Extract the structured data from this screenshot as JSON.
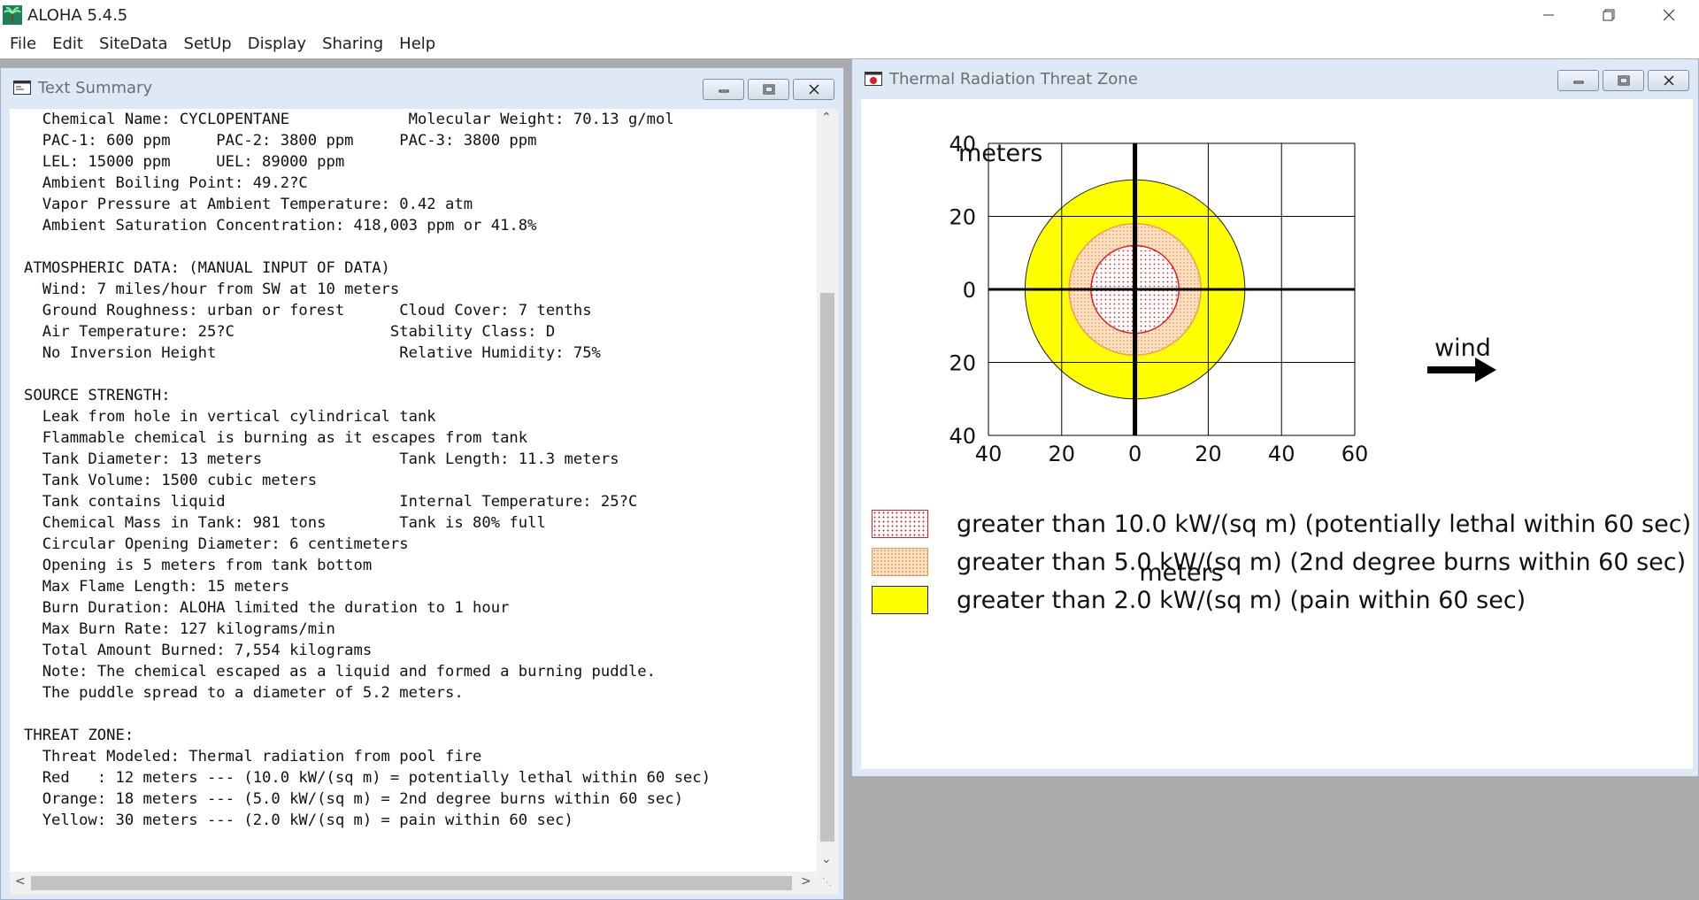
{
  "app": {
    "title": "ALOHA 5.4.5",
    "menu": [
      "File",
      "Edit",
      "SiteData",
      "SetUp",
      "Display",
      "Sharing",
      "Help"
    ]
  },
  "text_window": {
    "title": "Text Summary",
    "lines": [
      "  Chemical Name: CYCLOPENTANE             Molecular Weight: 70.13 g/mol",
      "  PAC-1: 600 ppm     PAC-2: 3800 ppm     PAC-3: 3800 ppm",
      "  LEL: 15000 ppm     UEL: 89000 ppm",
      "  Ambient Boiling Point: 49.2?C",
      "  Vapor Pressure at Ambient Temperature: 0.42 atm",
      "  Ambient Saturation Concentration: 418,003 ppm or 41.8%",
      "",
      "ATMOSPHERIC DATA: (MANUAL INPUT OF DATA)",
      "  Wind: 7 miles/hour from SW at 10 meters",
      "  Ground Roughness: urban or forest      Cloud Cover: 7 tenths",
      "  Air Temperature: 25?C                 Stability Class: D",
      "  No Inversion Height                    Relative Humidity: 75%",
      "",
      "SOURCE STRENGTH:",
      "  Leak from hole in vertical cylindrical tank",
      "  Flammable chemical is burning as it escapes from tank",
      "  Tank Diameter: 13 meters               Tank Length: 11.3 meters",
      "  Tank Volume: 1500 cubic meters",
      "  Tank contains liquid                   Internal Temperature: 25?C",
      "  Chemical Mass in Tank: 981 tons        Tank is 80% full",
      "  Circular Opening Diameter: 6 centimeters",
      "  Opening is 5 meters from tank bottom",
      "  Max Flame Length: 15 meters",
      "  Burn Duration: ALOHA limited the duration to 1 hour",
      "  Max Burn Rate: 127 kilograms/min",
      "  Total Amount Burned: 7,554 kilograms",
      "  Note: The chemical escaped as a liquid and formed a burning puddle.",
      "  The puddle spread to a diameter of 5.2 meters.",
      "",
      "THREAT ZONE:",
      "  Threat Modeled: Thermal radiation from pool fire",
      "  Red   : 12 meters --- (10.0 kW/(sq m) = potentially lethal within 60 sec)",
      "  Orange: 18 meters --- (5.0 kW/(sq m) = 2nd degree burns within 60 sec)",
      "  Yellow: 30 meters --- (2.0 kW/(sq m) = pain within 60 sec)"
    ]
  },
  "zone_window": {
    "title": "Thermal Radiation Threat Zone",
    "y_unit": "meters",
    "x_unit": "meters",
    "wind_label": "wind",
    "legend": [
      {
        "text": "greater than 10.0 kW/(sq m) (potentially lethal within 60 sec)",
        "color": "#ff2a2a"
      },
      {
        "text": "greater than 5.0 kW/(sq m) (2nd degree burns within 60 sec)",
        "color": "#f6b26b"
      },
      {
        "text": "greater than 2.0 kW/(sq m) (pain within 60 sec)",
        "color": "#ffff00"
      }
    ]
  },
  "chart_data": {
    "type": "threat-zone",
    "xlabel": "meters",
    "ylabel": "meters",
    "xlim": [
      -40,
      60
    ],
    "ylim": [
      -40,
      40
    ],
    "x_ticks": [
      "40",
      "20",
      "0",
      "20",
      "40",
      "60"
    ],
    "y_ticks": [
      "40",
      "20",
      "0",
      "20",
      "40"
    ],
    "x_tick_values": [
      -40,
      -20,
      0,
      20,
      40,
      60
    ],
    "y_tick_values": [
      40,
      20,
      0,
      -20,
      -40
    ],
    "grid": true,
    "zones": [
      {
        "name": "Yellow",
        "radius": 30,
        "color": "#ffff00",
        "pattern": "solid"
      },
      {
        "name": "Orange",
        "radius": 18,
        "color": "#f6b26b",
        "pattern": "dots"
      },
      {
        "name": "Red",
        "radius": 12,
        "color": "#ff2a2a",
        "pattern": "dots"
      }
    ]
  }
}
